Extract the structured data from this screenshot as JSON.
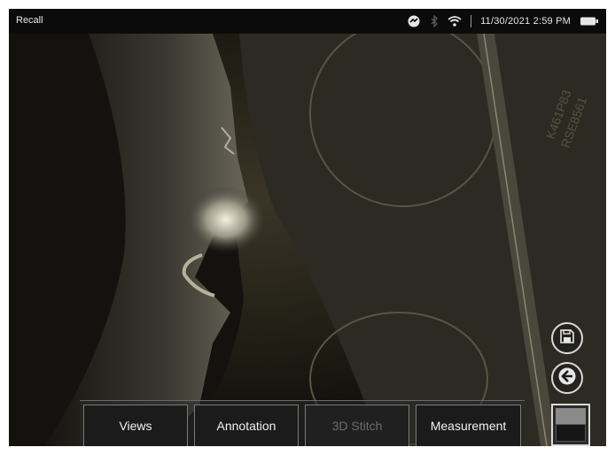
{
  "statusbar": {
    "app_title": "Recall",
    "datetime": "11/30/2021 2:59 PM",
    "icons": [
      "sync-icon",
      "bluetooth-icon",
      "wifi-icon",
      "battery-icon"
    ]
  },
  "viewport": {
    "description_icons": [
      "save-icon",
      "back-arrow-icon"
    ]
  },
  "toolbar": {
    "views_label": "Views",
    "annotation_label": "Annotation",
    "stitch_label": "3D Stitch",
    "measurement_label": "Measurement"
  },
  "colors": {
    "toolbar_bg": "#1b1b1b",
    "statusbar_bg": "#0b0b0b",
    "disabled_text": "#6c6c6c"
  }
}
